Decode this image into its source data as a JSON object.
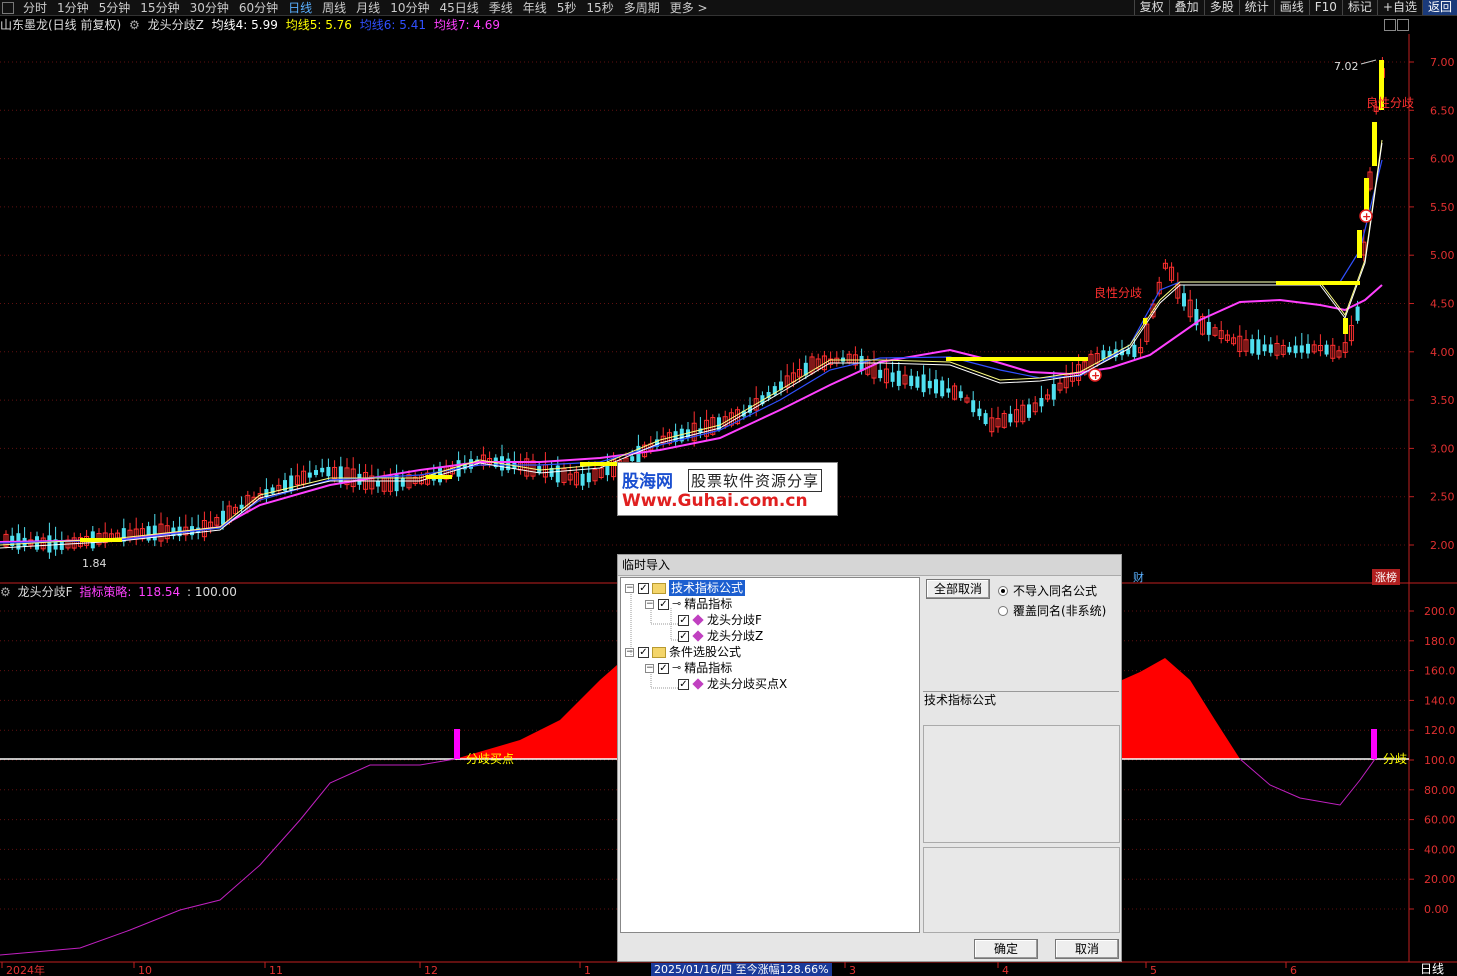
{
  "topbar": {
    "periods": [
      "分时",
      "1分钟",
      "5分钟",
      "15分钟",
      "30分钟",
      "60分钟",
      "日线",
      "周线",
      "月线",
      "10分钟",
      "45日线",
      "季线",
      "年线",
      "5秒",
      "15秒",
      "多周期",
      "更多 >"
    ],
    "active_index": 6,
    "tools": [
      "复权",
      "叠加",
      "多股",
      "统计",
      "画线",
      "F10",
      "标记",
      "+自选",
      "返回"
    ]
  },
  "chart_title": {
    "stock": "山东墨龙(日线 前复权)",
    "indicator": "龙头分歧Z",
    "ma4": "均线4: 5.99",
    "ma5": "均线5: 5.76",
    "ma6": "均线6: 5.41",
    "ma7": "均线7: 4.69",
    "colors": {
      "ma4": "#ffffff",
      "ma5": "#ffff00",
      "ma6": "#3050ff",
      "ma7": "#ff40ff"
    }
  },
  "main_axis": {
    "labels": [
      "7.00",
      "6.50",
      "6.00",
      "5.50",
      "5.00",
      "4.50",
      "4.00",
      "3.50",
      "3.00",
      "2.50",
      "2.00"
    ]
  },
  "annotations": {
    "high_label": "7.02",
    "low_label": "1.84",
    "signal_1": "良性分歧",
    "signal_2": "良性分歧",
    "badge_cai": "财",
    "badge_zhang": "涨榜"
  },
  "sub_title": {
    "name": "龙头分歧F",
    "label": "指标策略:",
    "value": "118.54",
    "value2": ": 100.00"
  },
  "sub_axis": {
    "labels": [
      "200.0",
      "180.0",
      "160.0",
      "140.0",
      "120.0",
      "100.0",
      "80.00",
      "60.00",
      "40.00",
      "20.00",
      "0.00"
    ]
  },
  "sub_annotations": {
    "buy_point": "分歧买点",
    "right_label": "分歧"
  },
  "time_axis": {
    "labels": [
      "2024年",
      "10",
      "11",
      "12",
      "1",
      "3",
      "4",
      "5",
      "6"
    ],
    "cursor_label": "2025/01/16/四  至今涨幅128.66%",
    "period_label": "日线"
  },
  "watermark": {
    "brand": "股海网",
    "tagline": "股票软件资源分享",
    "url": "Www.Guhai.com.cn"
  },
  "dialog": {
    "title": "临时导入",
    "tree": [
      {
        "level": 0,
        "label": "技术指标公式",
        "kind": "folder",
        "selected": true
      },
      {
        "level": 1,
        "label": "精品指标",
        "kind": "key"
      },
      {
        "level": 2,
        "label": "龙头分歧F",
        "kind": "formula"
      },
      {
        "level": 2,
        "label": "龙头分歧Z",
        "kind": "formula"
      },
      {
        "level": 0,
        "label": "条件选股公式",
        "kind": "folder"
      },
      {
        "level": 1,
        "label": "精品指标",
        "kind": "key"
      },
      {
        "level": 2,
        "label": "龙头分歧买点X",
        "kind": "formula"
      }
    ],
    "cancel_all": "全部取消",
    "radio_no_import": "不导入同名公式",
    "radio_overwrite": "覆盖同名(非系统)",
    "info_label": "技术指标公式",
    "ok": "确定",
    "cancel": "取消"
  }
}
